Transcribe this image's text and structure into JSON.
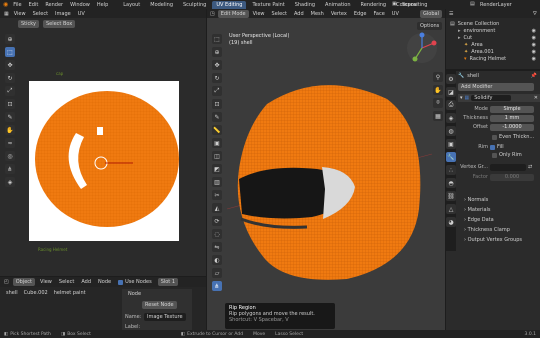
{
  "topbar": {
    "menus": [
      "File",
      "Edit",
      "Render",
      "Window",
      "Help"
    ],
    "tabs": [
      "Layout",
      "Modeling",
      "Sculpting",
      "UV Editing",
      "Texture Paint",
      "Shading",
      "Animation",
      "Rendering",
      "Compositing"
    ],
    "active_tab": "UV Editing",
    "scene": "Scene",
    "view_layer": "RenderLayer"
  },
  "uv_editor": {
    "header": [
      "View",
      "Select",
      "Image",
      "UV"
    ],
    "sub_header": [
      "Sticky",
      "Select Box"
    ],
    "labels": [
      "cap",
      "Add Modifier",
      "Racing Helmet"
    ]
  },
  "viewport": {
    "mode": "Edit Mode",
    "header": [
      "View",
      "Select",
      "Add",
      "Mesh",
      "Vertex",
      "Edge",
      "Face",
      "UV"
    ],
    "transform": "Global",
    "overlay_title": "User Perspective (Local)",
    "overlay_sub": "(19) shell",
    "options": "Options",
    "tooltip_title": "Rip Region",
    "tooltip_desc": "Rip polygons and move the result.",
    "tooltip_shortcut": "Shortcut: V  Spacebar, V"
  },
  "node_editor": {
    "header": [
      "Object",
      "View",
      "Select",
      "Add",
      "Node"
    ],
    "use_nodes": "Use Nodes",
    "slot": "Slot 1",
    "breadcrumb": [
      "shell",
      "Cube.002",
      "helmet paint"
    ],
    "node_title": "Node",
    "node_button": "Reset Node",
    "name_label": "Name:",
    "name_value": "Image Texture",
    "label_label": "Label:"
  },
  "outliner": {
    "title": "Scene Collection",
    "items": [
      "environment",
      "Cut",
      "Area",
      "Area.001",
      "Racing Helmet"
    ]
  },
  "properties": {
    "object": "shell",
    "modifier": "Solidify",
    "add_modifier": "Add Modifier",
    "mode_label": "Mode",
    "mode_value": "Simple",
    "thickness_label": "Thickness",
    "thickness_value": "1 mm",
    "offset_label": "Offset",
    "offset_value": "-1.0000",
    "even_label": "Even Thickn...",
    "rim_label": "Rim",
    "fill_label": "Fill",
    "only_rim_label": "Only Rim",
    "vgroup_label": "Vertex Gr...",
    "factor_label": "Factor",
    "factor_value": "0.000",
    "sections": [
      "Normals",
      "Materials",
      "Edge Data",
      "Thickness Clamp",
      "Output Vertex Groups"
    ]
  },
  "statusbar": {
    "items": [
      "Pick Shortest Path",
      "Box Select",
      "Extrude to Cursor or Add",
      "Move",
      "Lasso Select"
    ],
    "version": "3.0.1"
  },
  "colors": {
    "accent": "#4772b3",
    "mesh": "#f07a10",
    "background": "#1d1d1d",
    "uv_canvas": "#ffffff"
  }
}
